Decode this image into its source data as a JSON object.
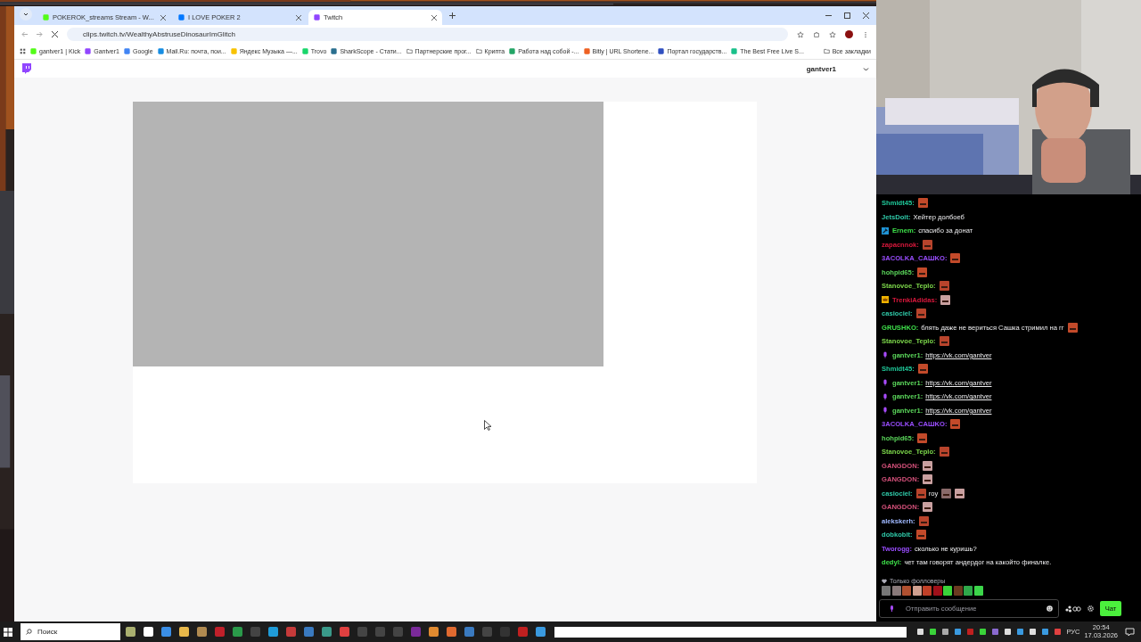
{
  "browser": {
    "tabs": [
      {
        "title": "POKEROK_streams Stream - W...",
        "kind": "kick",
        "selected": false
      },
      {
        "title": "I LOVE POKER 2",
        "kind": "vk",
        "selected": false
      },
      {
        "title": "Twitch",
        "kind": "twitch",
        "selected": true
      }
    ],
    "address": "clips.twitch.tv/WealthyAbstruseDinosaurImGlitch",
    "bookmarks": [
      {
        "label": "gantver1 | Kick",
        "kind": "kick"
      },
      {
        "label": "Gantver1",
        "kind": "twitch"
      },
      {
        "label": "Google",
        "kind": "google"
      },
      {
        "label": "Mail.Ru: почта, пои...",
        "kind": "mail"
      },
      {
        "label": "Яндекс Музыка —...",
        "kind": "star"
      },
      {
        "label": "Trovo",
        "kind": "trovo"
      },
      {
        "label": "SharkScope - Стати...",
        "kind": "shark"
      },
      {
        "label": "Партнерские прог...",
        "kind": "folder"
      },
      {
        "label": "Крипта",
        "kind": "folder"
      },
      {
        "label": "Работа над собой -...",
        "kind": "sheet"
      },
      {
        "label": "Bitly | URL Shortene...",
        "kind": "bitly"
      },
      {
        "label": "Портал государств...",
        "kind": "gov"
      },
      {
        "label": "The Best Free Live S...",
        "kind": "live"
      }
    ],
    "all_bookmarks": "Все закладки"
  },
  "site": {
    "user": "gantver1"
  },
  "chat": {
    "messages": [
      {
        "user": "Shmidt45:",
        "color": "#1fc99a",
        "kind": "plain",
        "parts": [
          {
            "kind": "emote"
          }
        ]
      },
      {
        "user": "JetsDoit:",
        "color": "#2fc9a8",
        "kind": "plain",
        "parts": [
          {
            "kind": "text",
            "text": "Хейтер долбоеб"
          }
        ]
      },
      {
        "user": "Ernem:",
        "color": "#3ee04a",
        "kind": "hammer",
        "parts": [
          {
            "kind": "text",
            "text": "спасибо за донат"
          }
        ]
      },
      {
        "user": "zapacnnok:",
        "color": "#d9183c",
        "kind": "plain",
        "parts": [
          {
            "kind": "emote"
          }
        ]
      },
      {
        "user": "3ACOLKA_CAШKO:",
        "color": "#9a4dff",
        "kind": "plain",
        "parts": [
          {
            "kind": "emote"
          }
        ]
      },
      {
        "user": "hohpid65:",
        "color": "#5ad65a",
        "kind": "plain",
        "parts": [
          {
            "kind": "emote"
          }
        ]
      },
      {
        "user": "Stanovoe_Teplo:",
        "color": "#7cd64a",
        "kind": "plain",
        "parts": [
          {
            "kind": "emote"
          }
        ]
      },
      {
        "user": "TrenkiAdidas:",
        "color": "#d9183c",
        "kind": "crown",
        "parts": [
          {
            "kind": "emote"
          }
        ]
      },
      {
        "user": "casiociel:",
        "color": "#2fc9a8",
        "kind": "plain",
        "parts": [
          {
            "kind": "emote"
          }
        ]
      },
      {
        "user": "GRUSHKO:",
        "color": "#3ee04a",
        "kind": "plain",
        "parts": [
          {
            "kind": "text",
            "text": "блять даже не вериться Сашка стримил на гг"
          },
          {
            "kind": "emote"
          }
        ]
      },
      {
        "user": "Stanovoe_Teplo:",
        "color": "#7cd64a",
        "kind": "plain",
        "parts": [
          {
            "kind": "emote"
          }
        ]
      },
      {
        "user": "gantver1:",
        "color": "#5ad65a",
        "kind": "mic",
        "parts": [
          {
            "kind": "link",
            "text": "https://vk.com/gantver"
          }
        ]
      },
      {
        "user": "Shmidt45:",
        "color": "#1fc99a",
        "kind": "plain",
        "parts": [
          {
            "kind": "emote"
          }
        ]
      },
      {
        "user": "gantver1:",
        "color": "#5ad65a",
        "kind": "mic",
        "parts": [
          {
            "kind": "link",
            "text": "https://vk.com/gantver"
          }
        ]
      },
      {
        "user": "gantver1:",
        "color": "#5ad65a",
        "kind": "mic",
        "parts": [
          {
            "kind": "link",
            "text": "https://vk.com/gantver"
          }
        ]
      },
      {
        "user": "gantver1:",
        "color": "#5ad65a",
        "kind": "mic",
        "parts": [
          {
            "kind": "link",
            "text": "https://vk.com/gantver"
          }
        ]
      },
      {
        "user": "3ACOLKA_CAШKO:",
        "color": "#9a4dff",
        "kind": "plain",
        "parts": [
          {
            "kind": "emote"
          }
        ]
      },
      {
        "user": "hohpid65:",
        "color": "#5ad65a",
        "kind": "plain",
        "parts": [
          {
            "kind": "emote"
          }
        ]
      },
      {
        "user": "Stanovoe_Teplo:",
        "color": "#7cd64a",
        "kind": "plain",
        "parts": [
          {
            "kind": "emote"
          }
        ]
      },
      {
        "user": "GANGDON:",
        "color": "#d4507a",
        "kind": "plain",
        "parts": [
          {
            "kind": "emote"
          }
        ]
      },
      {
        "user": "GANGDON:",
        "color": "#d4507a",
        "kind": "plain",
        "parts": [
          {
            "kind": "emote"
          }
        ]
      },
      {
        "user": "casiociel:",
        "color": "#2fc9a8",
        "kind": "plain",
        "parts": [
          {
            "kind": "emote"
          },
          {
            "kind": "text",
            "text": "roy"
          },
          {
            "kind": "emote"
          },
          {
            "kind": "emote"
          }
        ]
      },
      {
        "user": "GANGDON:",
        "color": "#d4507a",
        "kind": "plain",
        "parts": [
          {
            "kind": "emote"
          }
        ]
      },
      {
        "user": "alekskerh:",
        "color": "#9fb8ff",
        "kind": "plain",
        "parts": [
          {
            "kind": "emote"
          }
        ]
      },
      {
        "user": "dobkobit:",
        "color": "#2fc9a8",
        "kind": "plain",
        "parts": [
          {
            "kind": "emote"
          }
        ]
      },
      {
        "user": "Tworogg:",
        "color": "#9a4dff",
        "kind": "plain",
        "parts": [
          {
            "kind": "text",
            "text": "сколько не куришь?"
          }
        ]
      },
      {
        "user": "dedyl:",
        "color": "#3ee04a",
        "kind": "plain",
        "parts": [
          {
            "kind": "text",
            "text": "чет там говорят андердог на какойто финалке."
          }
        ]
      }
    ],
    "mode": "Только фолловеры",
    "placeholder": "Отправить сообщение",
    "send": "Чат"
  },
  "taskbar": {
    "search": "Поиск",
    "language": "РУС",
    "time": "20:54",
    "date": "17.03.2026"
  }
}
